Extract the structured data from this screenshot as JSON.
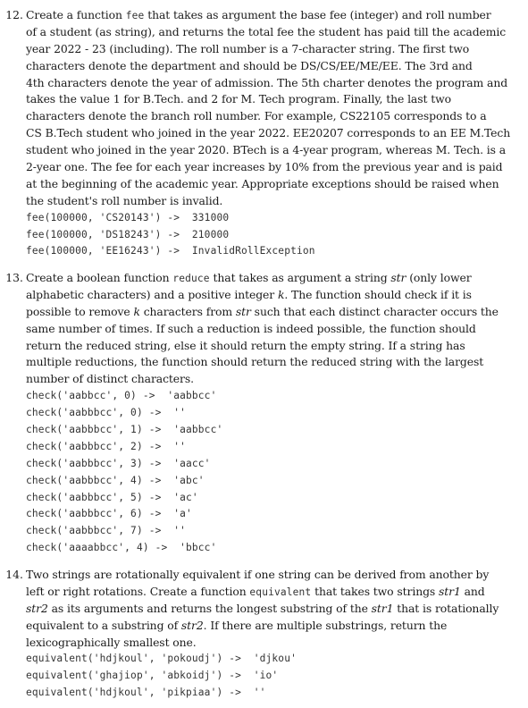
{
  "problems": [
    {
      "number": "12.",
      "lines": [
        [
          {
            "t": "Create a function "
          },
          {
            "c": "fee"
          },
          {
            "t": " that takes as argument the base fee (integer) and roll number"
          }
        ],
        [
          {
            "t": "of a student (as string), and returns the total fee the student has paid till the academic"
          }
        ],
        [
          {
            "t": "year 2022 - 23 (including). The roll number is a 7-character string. The first two"
          }
        ],
        [
          {
            "t": "characters denote the department and should be DS/CS/EE/ME/EE. The 3rd and"
          }
        ],
        [
          {
            "t": "4th characters denote the year of admission. The 5th charter denotes the program and"
          }
        ],
        [
          {
            "t": "takes the value 1 for B.Tech. and 2 for M. Tech program. Finally, the last two"
          }
        ],
        [
          {
            "t": "characters denote the branch roll number.  For example, CS22105  corresponds to a"
          }
        ],
        [
          {
            "t": "CS B.Tech student who joined in the year 2022. EE20207 corresponds to an EE M.Tech"
          }
        ],
        [
          {
            "t": "student who joined in the year 2020. BTech is a 4-year program, whereas M. Tech. is a"
          }
        ],
        [
          {
            "t": "2-year one. The fee for each year increases by 10% from the previous year and is paid"
          }
        ],
        [
          {
            "t": "at the beginning of the academic year. Appropriate exceptions should be raised when"
          }
        ],
        [
          {
            "t": "the student's roll number is invalid."
          }
        ]
      ],
      "examples": [
        "fee(100000, 'CS20143') ->  331000",
        "fee(100000, 'DS18243') ->  210000",
        "fee(100000, 'EE16243') ->  InvalidRollException"
      ]
    },
    {
      "number": "13.",
      "lines": [
        [
          {
            "t": "Create a boolean function "
          },
          {
            "c": "reduce"
          },
          {
            "t": " that takes as argument a string "
          },
          {
            "i": "str"
          },
          {
            "t": " (only lower"
          }
        ],
        [
          {
            "t": "alphabetic characters) and a positive integer "
          },
          {
            "i": "k"
          },
          {
            "t": ". The function should check if it is"
          }
        ],
        [
          {
            "t": "possible to remove "
          },
          {
            "i": "k"
          },
          {
            "t": " characters from "
          },
          {
            "i": "str"
          },
          {
            "t": " such that each distinct character occurs the"
          }
        ],
        [
          {
            "t": "same number of times. If such a reduction is indeed possible, the function should"
          }
        ],
        [
          {
            "t": "return the reduced string, else it should return the empty string. If a string has"
          }
        ],
        [
          {
            "t": "multiple reductions, the function should return the reduced string with the largest"
          }
        ],
        [
          {
            "t": "number of distinct characters."
          }
        ]
      ],
      "examples": [
        "check('aabbcc', 0) ->  'aabbcc'",
        "check('aabbbcc', 0) ->  ''",
        "check('aabbbcc', 1) ->  'aabbcc'",
        "check('aabbbcc', 2) ->  ''",
        "check('aabbbcc', 3) ->  'aacc'",
        "check('aabbbcc', 4) ->  'abc'",
        "check('aabbbcc', 5) ->  'ac'",
        "check('aabbbcc', 6) ->  'a'",
        "check('aabbbcc', 7) ->  ''",
        "check('aaaabbcc', 4) ->  'bbcc'"
      ]
    },
    {
      "number": "14.",
      "lines": [
        [
          {
            "t": "Two strings are rotationally equivalent if one string can be derived from another by"
          }
        ],
        [
          {
            "t": "left or right rotations. Create a function "
          },
          {
            "c": "equivalent"
          },
          {
            "t": " that takes two strings "
          },
          {
            "i": "str1"
          },
          {
            "t": " and"
          }
        ],
        [
          {
            "i": "str2"
          },
          {
            "t": " as its arguments and returns the longest substring of the "
          },
          {
            "i": "str1"
          },
          {
            "t": " that is rotationally"
          }
        ],
        [
          {
            "t": "equivalent to a substring of "
          },
          {
            "i": "str2"
          },
          {
            "t": ". If there are multiple substrings, return the"
          }
        ],
        [
          {
            "t": "lexicographically smallest one."
          }
        ]
      ],
      "examples": [
        "equivalent('hdjkoul', 'pokoudj') ->  'djkou'",
        "equivalent('ghajiop', 'abkoidj') ->  'io'",
        "equivalent('hdjkoul', 'pikpiaa') ->  ''"
      ]
    }
  ]
}
